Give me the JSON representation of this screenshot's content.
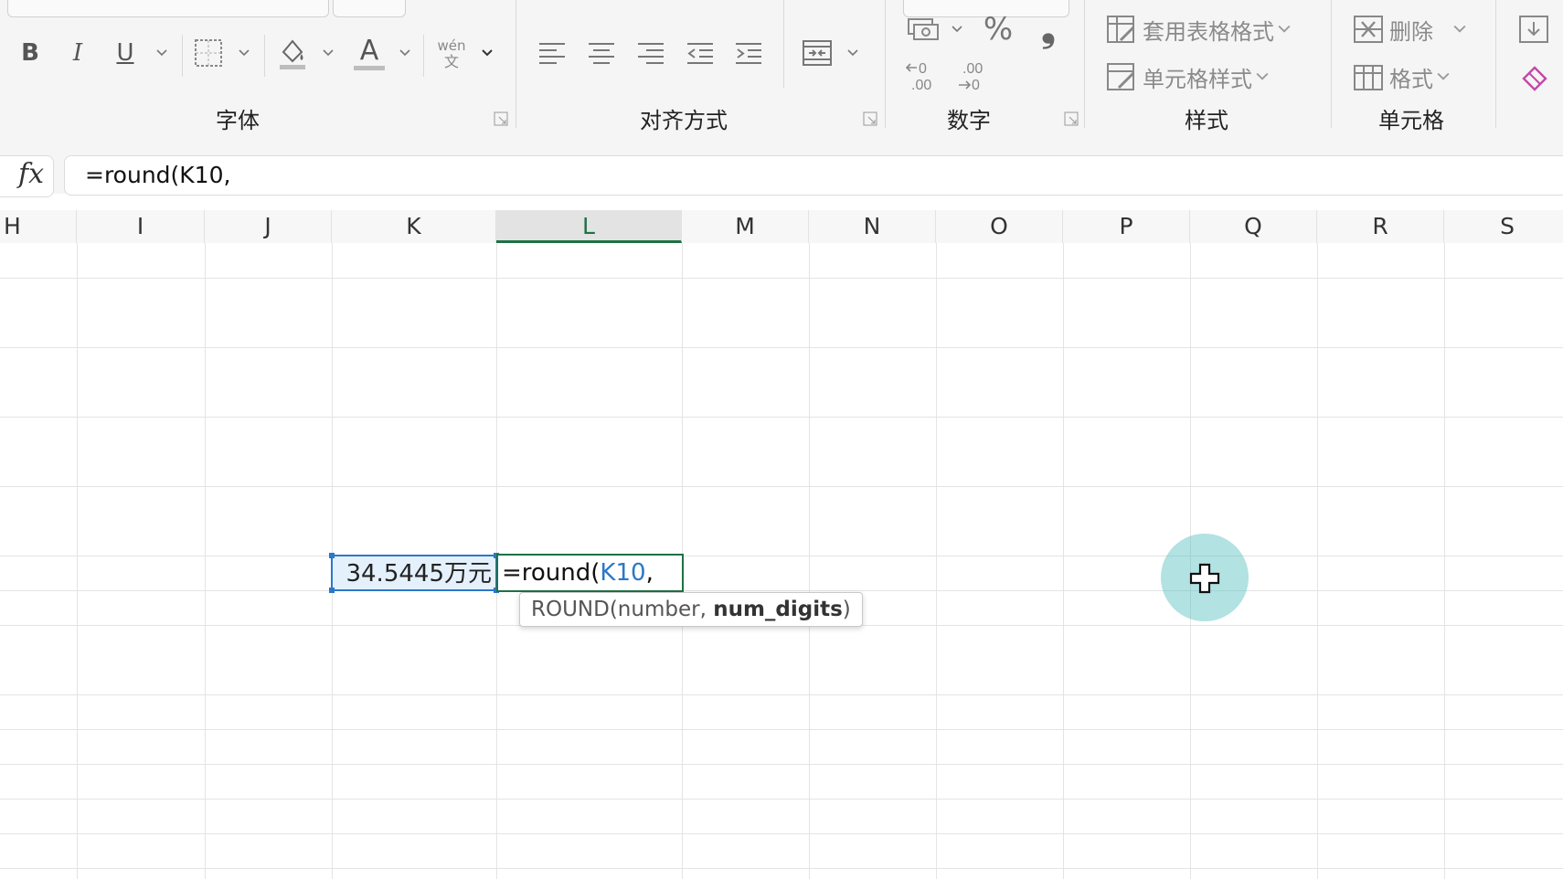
{
  "ribbon": {
    "groups": {
      "font": "字体",
      "alignment": "对齐方式",
      "number": "数字",
      "styles": "样式",
      "cells": "单元格"
    },
    "font": {
      "bold": "B",
      "italic": "I",
      "underline": "U",
      "font_color_glyph": "A",
      "phonetic_top": "wén",
      "phonetic_bottom": "文"
    },
    "number": {
      "percent": "%",
      "comma": "❟"
    },
    "styles": {
      "format_as_table": "套用表格格式",
      "cell_styles": "单元格样式"
    },
    "cells": {
      "delete": "删除",
      "format": "格式"
    }
  },
  "formula_bar": {
    "fx_label": "fx",
    "value": "=round(K10,"
  },
  "columns": [
    "H",
    "I",
    "J",
    "K",
    "L",
    "M",
    "N",
    "O",
    "P",
    "Q",
    "R",
    "S"
  ],
  "active_column": "L",
  "cells": {
    "k10": "34.5445万元",
    "l10_prefix": "=round(",
    "l10_ref": "K10",
    "l10_suffix": ","
  },
  "tooltip": {
    "fn": "ROUND(number, ",
    "arg": "num_digits",
    "close": ")"
  },
  "colors": {
    "accent_green": "#1e7145",
    "reference_blue": "#2b78c7",
    "cursor_halo": "#54bebe"
  }
}
